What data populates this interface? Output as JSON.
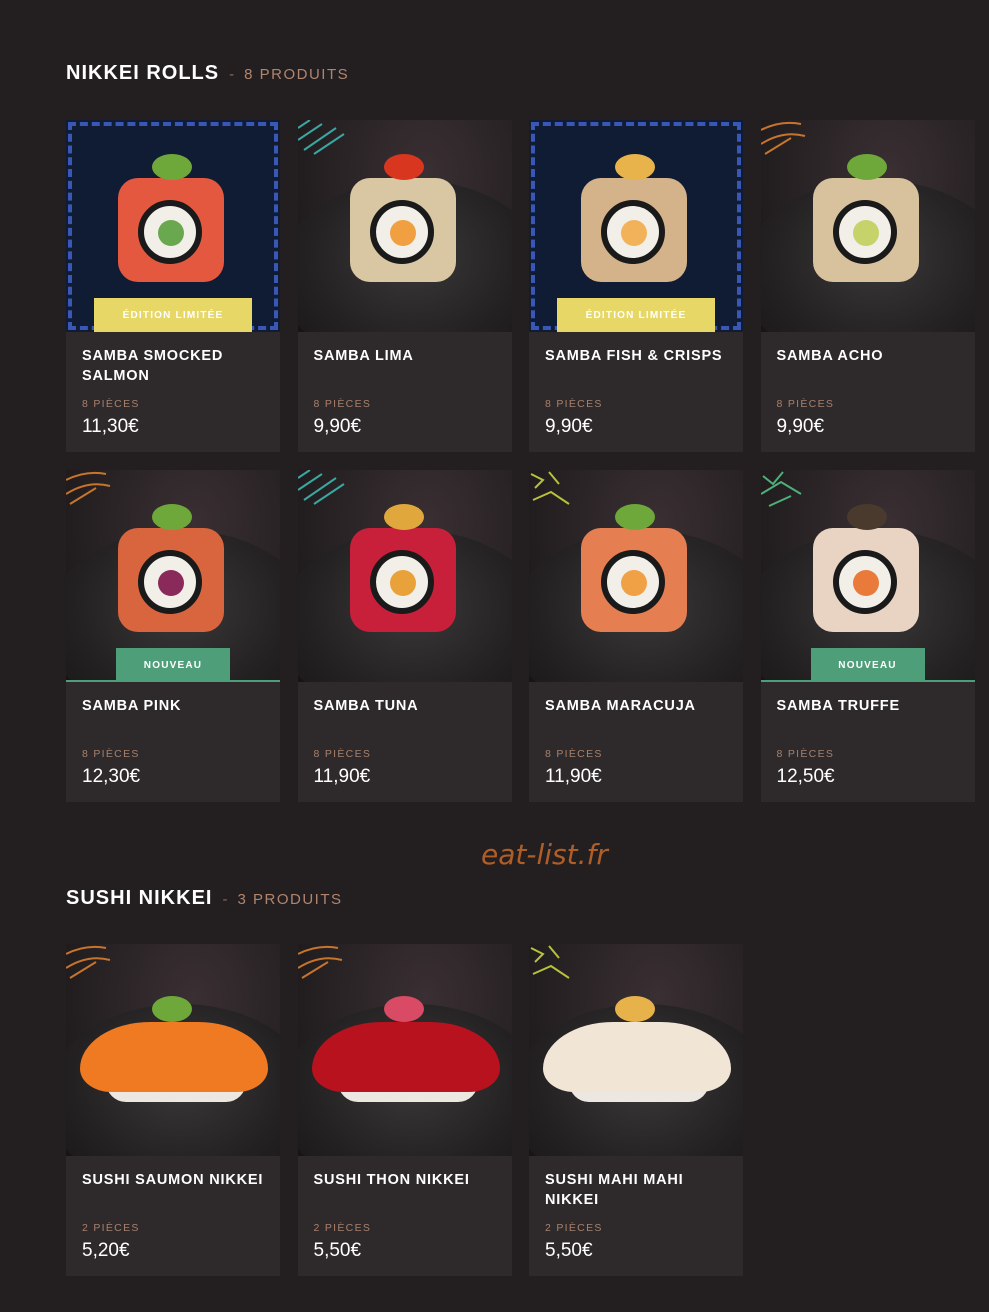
{
  "sections": [
    {
      "title": "NIKKEI ROLLS",
      "separator": "-",
      "count": "8 PRODUITS",
      "products": [
        {
          "name": "SAMBA SMOCKED SALMON",
          "pieces": "8 PIÈCES",
          "price": "11,30€",
          "badge": "ÉDITION LIMITÉE"
        },
        {
          "name": "SAMBA LIMA",
          "pieces": "8 PIÈCES",
          "price": "9,90€",
          "badge": ""
        },
        {
          "name": "SAMBA FISH & CRISPS",
          "pieces": "8 PIÈCES",
          "price": "9,90€",
          "badge": "ÉDITION LIMITÉE"
        },
        {
          "name": "SAMBA ACHO",
          "pieces": "8 PIÈCES",
          "price": "9,90€",
          "badge": ""
        },
        {
          "name": "SAMBA PINK",
          "pieces": "8 PIÈCES",
          "price": "12,30€",
          "badge": "NOUVEAU"
        },
        {
          "name": "SAMBA TUNA",
          "pieces": "8 PIÈCES",
          "price": "11,90€",
          "badge": ""
        },
        {
          "name": "SAMBA MARACUJA",
          "pieces": "8 PIÈCES",
          "price": "11,90€",
          "badge": ""
        },
        {
          "name": "SAMBA TRUFFE",
          "pieces": "8 PIÈCES",
          "price": "12,50€",
          "badge": "NOUVEAU"
        }
      ]
    },
    {
      "title": "SUSHI NIKKEI",
      "separator": "-",
      "count": "3 PRODUITS",
      "products": [
        {
          "name": "SUSHI SAUMON NIKKEI",
          "pieces": "2 PIÈCES",
          "price": "5,20€",
          "badge": ""
        },
        {
          "name": "SUSHI THON NIKKEI",
          "pieces": "2 PIÈCES",
          "price": "5,50€",
          "badge": ""
        },
        {
          "name": "SUSHI MAHI MAHI NIKKEI",
          "pieces": "2 PIÈCES",
          "price": "5,50€",
          "badge": ""
        }
      ]
    }
  ],
  "watermark": "eat-list.fr",
  "colors": {
    "background": "#231f20",
    "card": "#2e2a2b",
    "badge_limited": "#e6d767",
    "badge_new": "#4f9e7a",
    "accent_text": "#a8806c"
  }
}
